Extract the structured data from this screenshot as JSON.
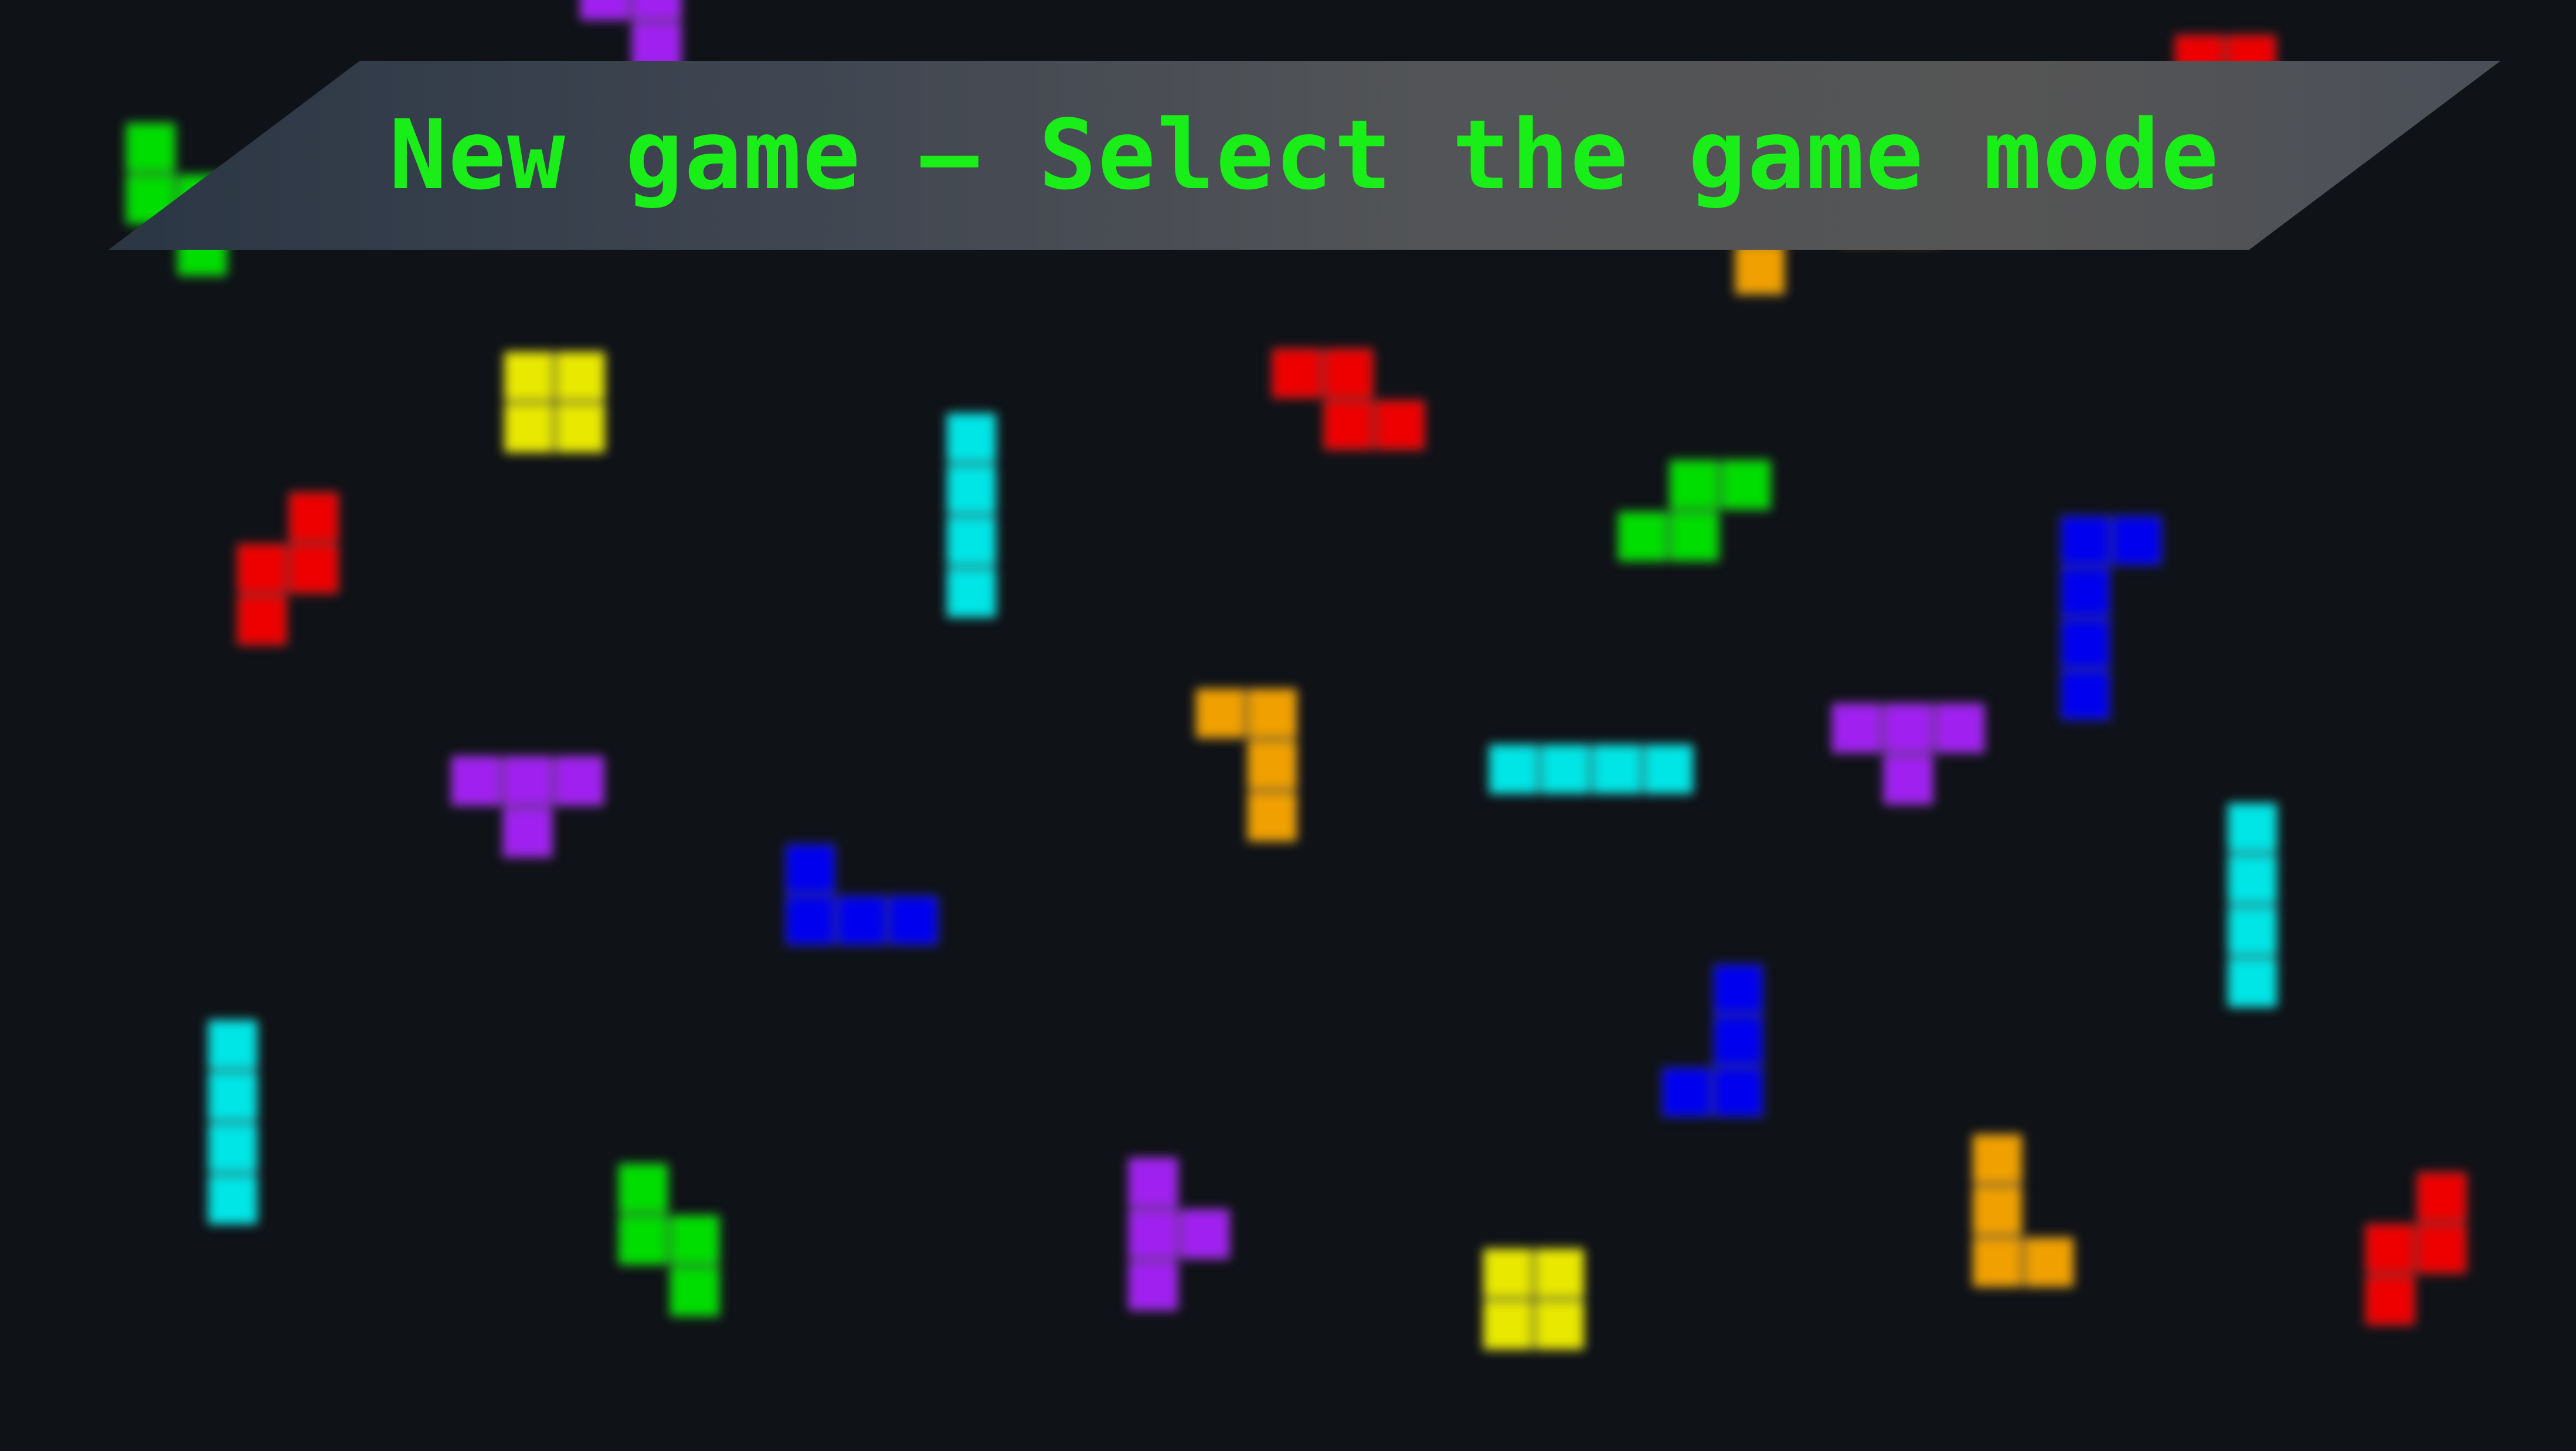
{
  "banner": {
    "title": "New game – Select the game mode"
  },
  "colors": {
    "background": "#0f1217",
    "title_text": "#19ee19",
    "piece_I": "#00e5e5",
    "piece_O": "#e8e800",
    "piece_T": "#a020f0",
    "piece_S": "#00dd00",
    "piece_Z": "#ee0000",
    "piece_L": "#f0a000",
    "piece_J": "#0000ee"
  },
  "background_pieces": [
    {
      "kind": "T",
      "color": "#a020f0"
    },
    {
      "kind": "S",
      "color": "#00dd00"
    },
    {
      "kind": "L",
      "color": "#f0a000"
    },
    {
      "kind": "Z",
      "color": "#ee0000"
    },
    {
      "kind": "O",
      "color": "#e8e800"
    },
    {
      "kind": "Z",
      "color": "#ee0000"
    },
    {
      "kind": "S",
      "color": "#00dd00"
    },
    {
      "kind": "J",
      "color": "#0000ee"
    },
    {
      "kind": "I",
      "color": "#00e5e5"
    },
    {
      "kind": "Z",
      "color": "#ee0000"
    },
    {
      "kind": "L",
      "color": "#f0a000"
    },
    {
      "kind": "I",
      "color": "#00e5e5"
    },
    {
      "kind": "T",
      "color": "#a020f0"
    },
    {
      "kind": "T",
      "color": "#a020f0"
    },
    {
      "kind": "J",
      "color": "#0000ee"
    },
    {
      "kind": "I",
      "color": "#00e5e5"
    },
    {
      "kind": "J",
      "color": "#0000ee"
    },
    {
      "kind": "I",
      "color": "#00e5e5"
    },
    {
      "kind": "S",
      "color": "#00dd00"
    },
    {
      "kind": "T",
      "color": "#a020f0"
    },
    {
      "kind": "O",
      "color": "#e8e800"
    },
    {
      "kind": "L",
      "color": "#f0a000"
    },
    {
      "kind": "Z",
      "color": "#ee0000"
    }
  ]
}
